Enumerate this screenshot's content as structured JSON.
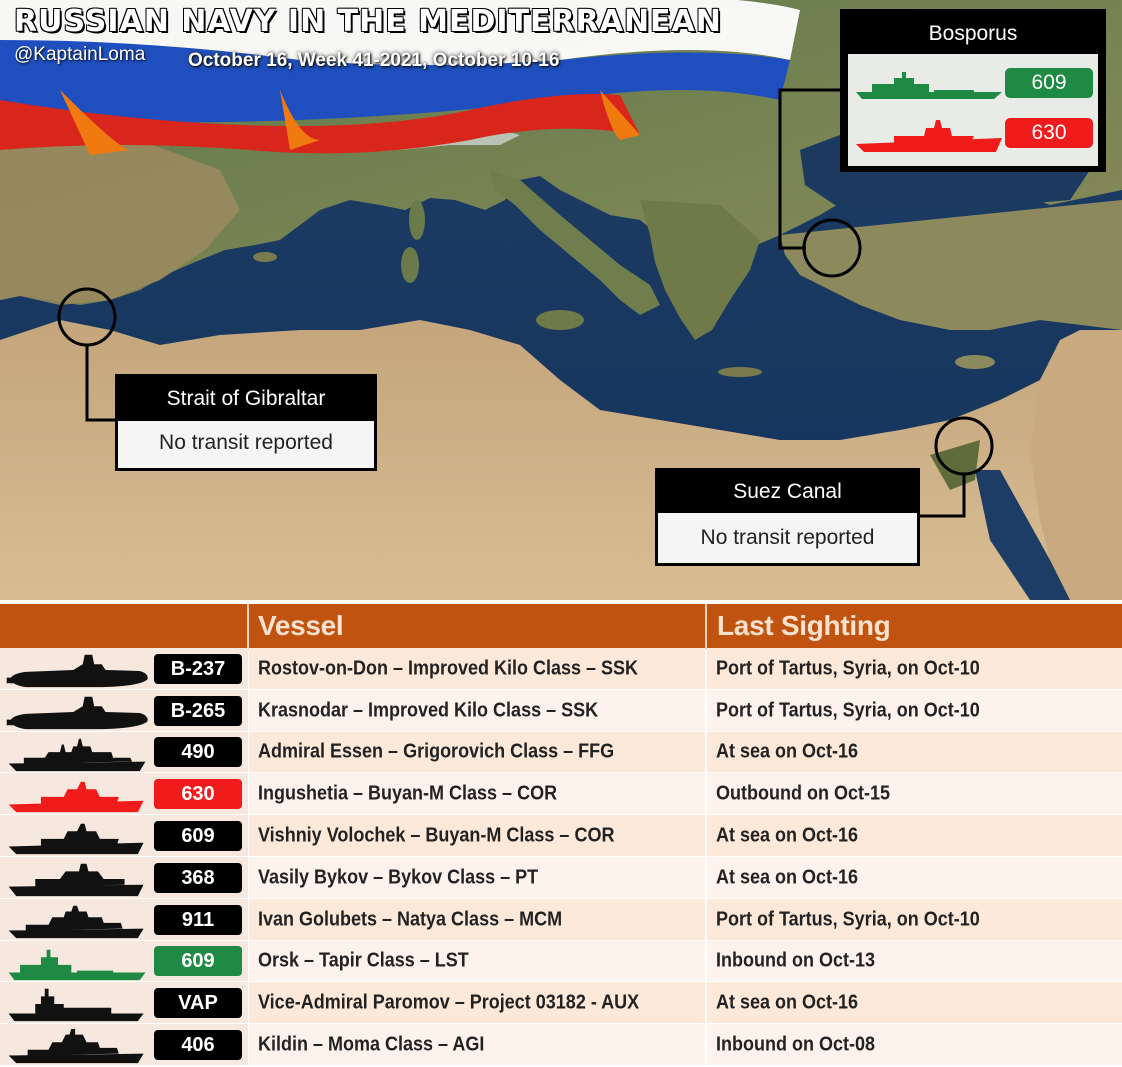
{
  "header": {
    "title": "RUSSIAN NAVY IN THE MEDITERRANEAN",
    "handle": "@KaptainLoma",
    "subtitle": "October 16, Week 41-2021, October 10-16"
  },
  "callouts": {
    "gibraltar": {
      "title": "Strait of Gibraltar",
      "status": "No transit reported"
    },
    "suez": {
      "title": "Suez Canal",
      "status": "No transit reported"
    },
    "bosporus": {
      "title": "Bosporus",
      "ships": [
        {
          "badge": "609",
          "color": "#1e8a44"
        },
        {
          "badge": "630",
          "color": "#f01b1b"
        }
      ]
    }
  },
  "table": {
    "headers": {
      "vessel": "Vessel",
      "last_sighting": "Last Sighting"
    },
    "rows": [
      {
        "badge": "B-237",
        "badge_color": "#000000",
        "ship_icon": "submarine-icon",
        "vessel": "Rostov-on-Don – Improved Kilo Class – SSK",
        "last_sighting": "Port of Tartus, Syria, on Oct-10"
      },
      {
        "badge": "B-265",
        "badge_color": "#000000",
        "ship_icon": "submarine-icon",
        "vessel": "Krasnodar – Improved Kilo Class – SSK",
        "last_sighting": "Port of Tartus, Syria, on Oct-10"
      },
      {
        "badge": "490",
        "badge_color": "#000000",
        "ship_icon": "frigate-icon",
        "vessel": "Admiral Essen – Grigorovich Class – FFG",
        "last_sighting": "At sea on Oct-16"
      },
      {
        "badge": "630",
        "badge_color": "#f01b1b",
        "ship_icon": "corvette-icon",
        "vessel": "Ingushetia – Buyan-M Class – COR",
        "last_sighting": "Outbound on Oct-15"
      },
      {
        "badge": "609",
        "badge_color": "#000000",
        "ship_icon": "corvette-icon",
        "vessel": "Vishniy Volochek – Buyan-M Class – COR",
        "last_sighting": "At sea on Oct-16"
      },
      {
        "badge": "368",
        "badge_color": "#000000",
        "ship_icon": "patrol-ship-icon",
        "vessel": "Vasily Bykov – Bykov Class – PT",
        "last_sighting": "At sea on Oct-16"
      },
      {
        "badge": "911",
        "badge_color": "#000000",
        "ship_icon": "minesweeper-icon",
        "vessel": "Ivan Golubets – Natya Class – MCM",
        "last_sighting": "Port of Tartus, Syria, on Oct-10"
      },
      {
        "badge": "609",
        "badge_color": "#1e8a44",
        "ship_icon": "landing-ship-icon",
        "vessel": "Orsk – Tapir Class – LST",
        "last_sighting": "Inbound on Oct-13"
      },
      {
        "badge": "VAP",
        "badge_color": "#000000",
        "ship_icon": "tanker-icon",
        "vessel": "Vice-Admiral Paromov – Project 03182 - AUX",
        "last_sighting": "At sea on Oct-16"
      },
      {
        "badge": "406",
        "badge_color": "#000000",
        "ship_icon": "intelligence-ship-icon",
        "vessel": "Kildin – Moma Class – AGI",
        "last_sighting": "Inbound on Oct-08"
      }
    ]
  }
}
